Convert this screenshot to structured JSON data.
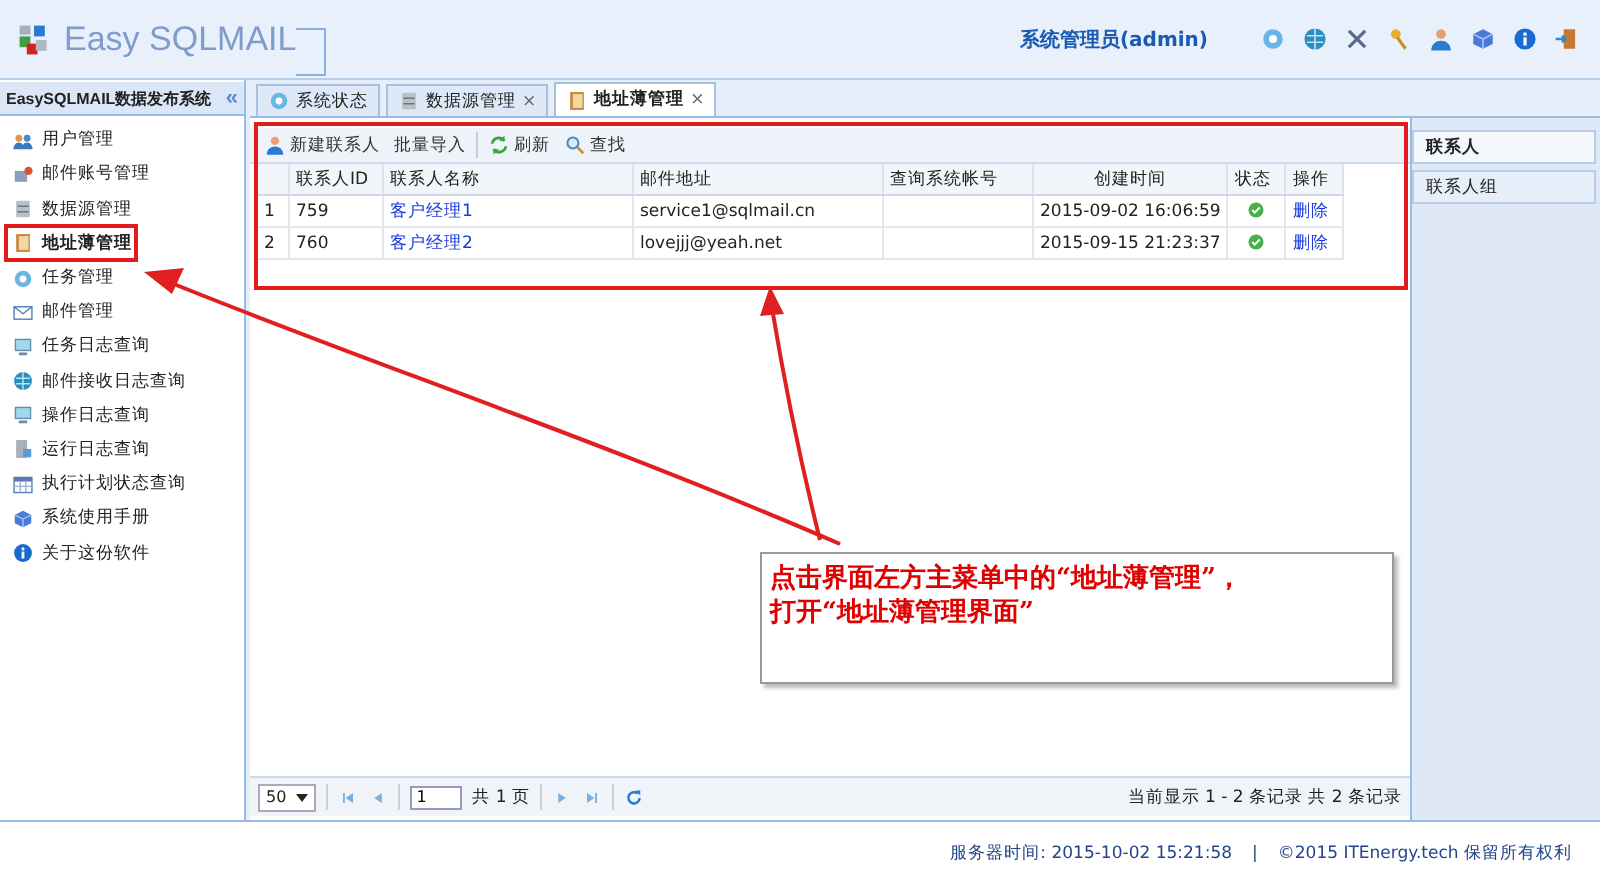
{
  "header": {
    "logo": "Easy SQLMAIL",
    "user": "系统管理员(admin)"
  },
  "sidebar": {
    "title": "EasySQLMAIL数据发布系统",
    "collapse": "«",
    "items": [
      {
        "label": "用户管理",
        "selected": false
      },
      {
        "label": "邮件账号管理",
        "selected": false
      },
      {
        "label": "数据源管理",
        "selected": false
      },
      {
        "label": "地址薄管理",
        "selected": true
      },
      {
        "label": "任务管理",
        "selected": false
      },
      {
        "label": "邮件管理",
        "selected": false
      },
      {
        "label": "任务日志查询",
        "selected": false
      },
      {
        "label": "邮件接收日志查询",
        "selected": false
      },
      {
        "label": "操作日志查询",
        "selected": false
      },
      {
        "label": "运行日志查询",
        "selected": false
      },
      {
        "label": "执行计划状态查询",
        "selected": false
      },
      {
        "label": "系统使用手册",
        "selected": false
      },
      {
        "label": "关于这份软件",
        "selected": false
      }
    ]
  },
  "tabs": [
    {
      "label": "系统状态",
      "closable": false,
      "selected": false
    },
    {
      "label": "数据源管理",
      "closable": true,
      "selected": false
    },
    {
      "label": "地址薄管理",
      "closable": true,
      "selected": true
    }
  ],
  "close_mark": "×",
  "toolbar": [
    {
      "label": "新建联系人"
    },
    {
      "label": "批量导入"
    },
    {
      "label": "刷新"
    },
    {
      "label": "查找"
    }
  ],
  "table": {
    "columns": [
      "联系人ID",
      "联系人名称",
      "邮件地址",
      "查询系统帐号",
      "创建时间",
      "状态",
      "操作"
    ],
    "rows": [
      {
        "num": "1",
        "id": "759",
        "name": "客户经理1",
        "email": "service1@sqlmail.cn",
        "created": "2015-09-02 16:06:59",
        "enabled": true,
        "action": "删除"
      },
      {
        "num": "2",
        "id": "760",
        "name": "客户经理2",
        "email": "lovejjj@yeah.net",
        "created": "2015-09-15 21:23:37",
        "enabled": true,
        "action": "删除"
      }
    ]
  },
  "pager": {
    "page_size": "50",
    "page": "1",
    "total_pages": "共 1 页",
    "summary": "当前显示 1 - 2 条记录 共 2 条记录"
  },
  "right_panel": [
    {
      "label": "联系人",
      "selected": true
    },
    {
      "label": "联系人组",
      "selected": false
    }
  ],
  "footer": {
    "server_time": "服务器时间:  2015-10-02 15:21:58",
    "separator": "|",
    "copyright": "©2015 ITEnergy.tech 保留所有权利"
  },
  "annotation": {
    "lines": [
      "点击界面左方主菜单中的“地址薄管理”，",
      "打开“地址薄管理界面”"
    ]
  }
}
